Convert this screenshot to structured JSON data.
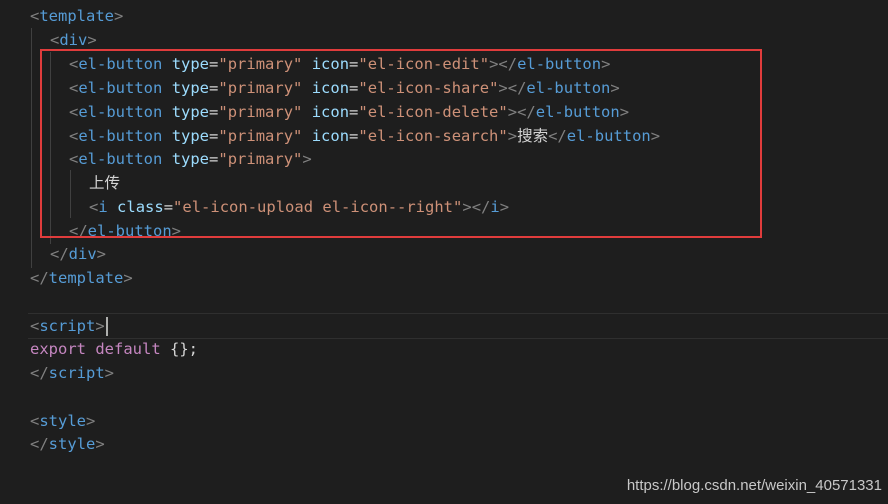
{
  "code": {
    "template_open_tag": "template",
    "div_open_tag": "div",
    "buttons": [
      {
        "tag": "el-button",
        "type_attr": "type",
        "type_val": "primary",
        "icon_attr": "icon",
        "icon_val": "el-icon-edit",
        "content": ""
      },
      {
        "tag": "el-button",
        "type_attr": "type",
        "type_val": "primary",
        "icon_attr": "icon",
        "icon_val": "el-icon-share",
        "content": ""
      },
      {
        "tag": "el-button",
        "type_attr": "type",
        "type_val": "primary",
        "icon_attr": "icon",
        "icon_val": "el-icon-delete",
        "content": ""
      },
      {
        "tag": "el-button",
        "type_attr": "type",
        "type_val": "primary",
        "icon_attr": "icon",
        "icon_val": "el-icon-search",
        "content": "搜索"
      }
    ],
    "upload_button": {
      "tag": "el-button",
      "type_attr": "type",
      "type_val": "primary",
      "text": "上传",
      "i_tag": "i",
      "class_attr": "class",
      "class_val": "el-icon-upload el-icon--right"
    },
    "div_close_tag": "div",
    "template_close_tag": "template",
    "script_tag": "script",
    "export_kw": "export",
    "default_kw": "default",
    "export_rest": " {};",
    "style_tag": "style"
  },
  "watermark": "https://blog.csdn.net/weixin_40571331",
  "colors": {
    "background": "#1e1e1e",
    "tag": "#569cd6",
    "attribute": "#9cdcfe",
    "string": "#ce9178",
    "keyword": "#c586c0",
    "highlight_border": "#e03c3c"
  }
}
